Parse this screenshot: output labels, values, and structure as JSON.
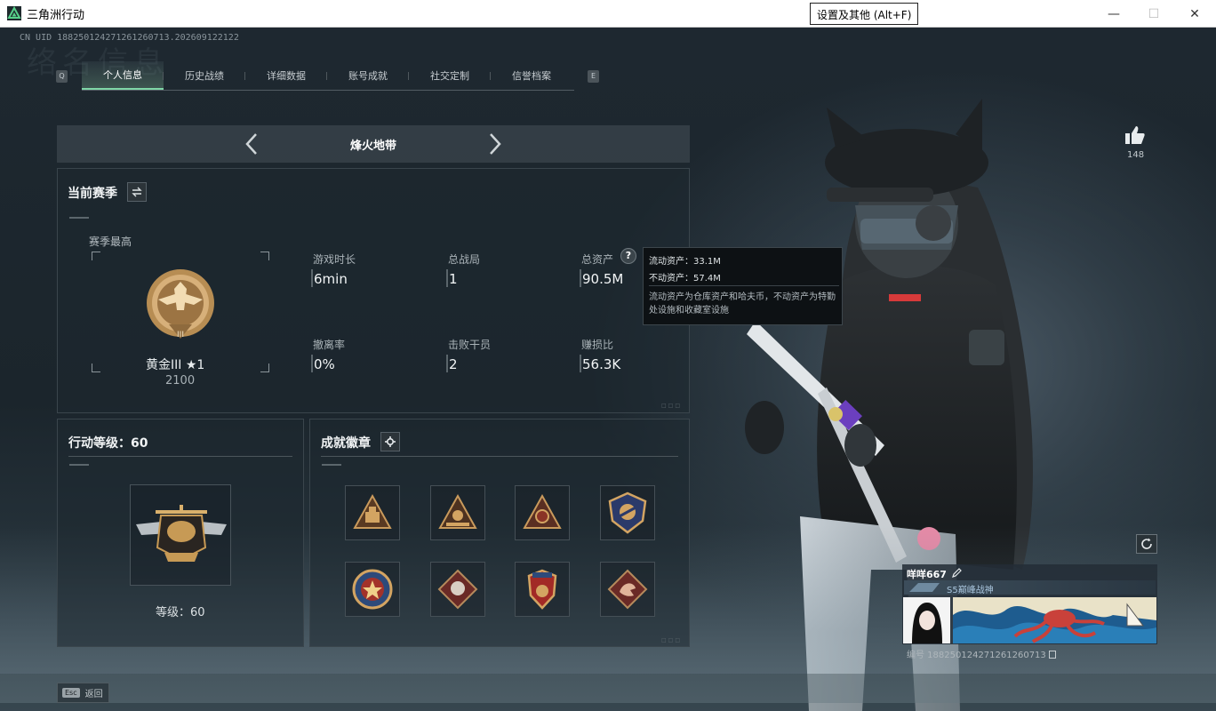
{
  "window": {
    "title": "三角洲行动",
    "settings_tooltip": "设置及其他 (Alt+F)",
    "minimize": "—",
    "maximize": "☐",
    "close": "✕"
  },
  "uid": "CN UID 1882501242712612607 13.202609122122",
  "uid_text": "CN UID 188250124271261260713.202609122122",
  "bg_watermark": "络名信息",
  "tabs": {
    "left_key": "Q",
    "right_key": "E",
    "items": [
      {
        "label": "个人信息",
        "active": true
      },
      {
        "label": "历史战绩"
      },
      {
        "label": "详细数据"
      },
      {
        "label": "账号成就"
      },
      {
        "label": "社交定制"
      },
      {
        "label": "信誉档案"
      }
    ]
  },
  "mode": {
    "title": "烽火地带"
  },
  "season": {
    "title": "当前赛季",
    "best_label": "赛季最高",
    "rank_name": "黄金III ★1",
    "rank_score": "2100",
    "stats": [
      {
        "label": "游戏时长",
        "value": "6min"
      },
      {
        "label": "总战局",
        "value": "1"
      },
      {
        "label": "总资产",
        "value": "90.5M"
      },
      {
        "label": "撤离率",
        "value": "0%"
      },
      {
        "label": "击败干员",
        "value": "2"
      },
      {
        "label": "赚损比",
        "value": "56.3K"
      }
    ]
  },
  "tooltip": {
    "liquid": "流动资产：33.1M",
    "fixed": "不动资产：57.4M",
    "desc": "流动资产为仓库资产和哈夫币，不动资产为特勤处设施和收藏室设施"
  },
  "level": {
    "title": "行动等级：60",
    "text": "等级：60"
  },
  "badges": {
    "title": "成就徽章"
  },
  "social": {
    "like_count": "148"
  },
  "player": {
    "name": "咩咩667",
    "title": "S5巅峰战神",
    "id_label": "编号 188250124271261260713"
  },
  "footer": {
    "esc_key": "Esc",
    "esc_label": "返回"
  },
  "colors": {
    "accent": "#7fd6a6",
    "gold": "#c9a05a",
    "panel_border": "#3a454c"
  }
}
